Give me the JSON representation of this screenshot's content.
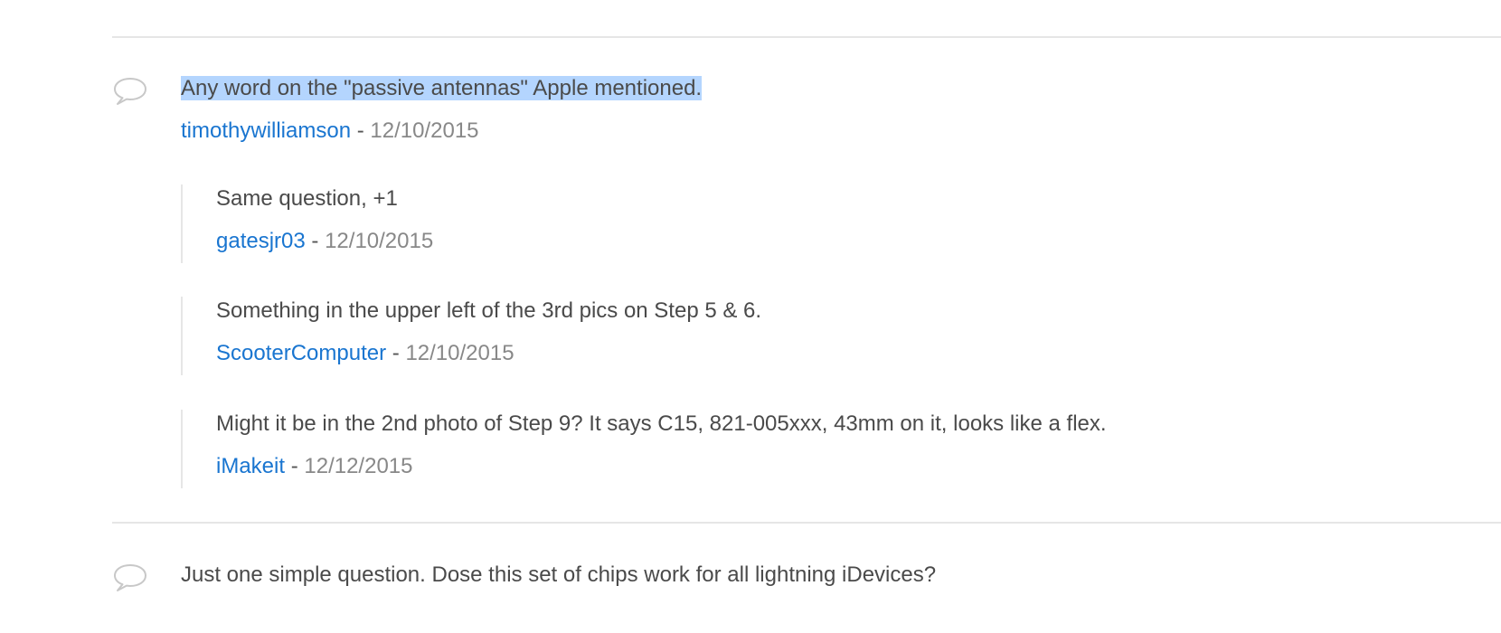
{
  "comments": [
    {
      "text": "Any word on the \"passive antennas\" Apple mentioned.",
      "author": "timothywilliamson",
      "separator": "-",
      "date": "12/10/2015",
      "replies": [
        {
          "text": "Same question, +1",
          "author": "gatesjr03",
          "separator": "-",
          "date": "12/10/2015"
        },
        {
          "text": "Something in the upper left of the 3rd pics on Step 5 & 6.",
          "author": "ScooterComputer",
          "separator": "-",
          "date": "12/10/2015"
        },
        {
          "text": "Might it be in the 2nd photo of Step 9? It says C15, 821-005xxx, 43mm on it, looks like a flex.",
          "author": "iMakeit",
          "separator": "-",
          "date": "12/12/2015"
        }
      ]
    },
    {
      "text": "Just one simple question. Dose this set of chips work for all lightning iDevices?"
    }
  ],
  "icons": {
    "comment": "speech-bubble-icon"
  },
  "colors": {
    "author_link": "#1975d0",
    "text": "#4a4a4a",
    "date": "#888888",
    "divider": "#e6e6e6",
    "selection_highlight": "#b4d5fe"
  }
}
